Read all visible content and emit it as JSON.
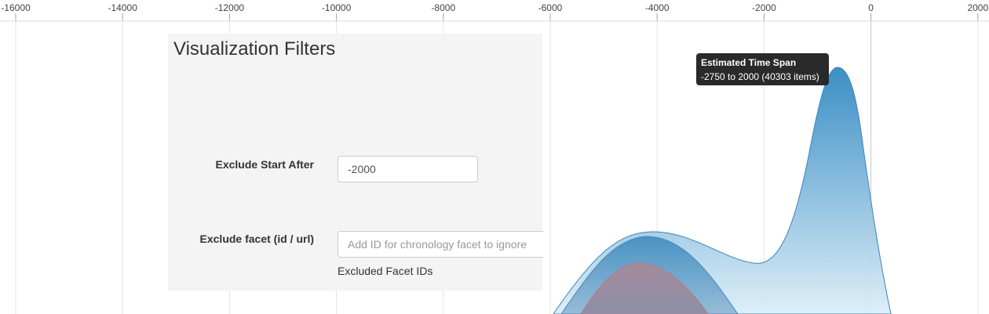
{
  "axis": {
    "ticks": [
      "-16000",
      "-14000",
      "-12000",
      "-10000",
      "-8000",
      "-6000",
      "-4000",
      "-2000",
      "0",
      "2000"
    ]
  },
  "filters_panel": {
    "title": "Visualization Filters",
    "exclude_start_after": {
      "label": "Exclude Start After",
      "value": "-2000"
    },
    "exclude_facet": {
      "label": "Exclude facet (id / url)",
      "placeholder": "Add ID for chronology facet to ignore",
      "help": "Excluded Facet IDs"
    }
  },
  "tooltip": {
    "title": "Estimated Time Span",
    "body": "-2750 to 2000 (40303 items)"
  },
  "colors": {
    "series_primary": "#3a8dc3",
    "series_secondary": "#6aa0c8",
    "series_overlap": "#9e8d9f",
    "tooltip_bg": "#2a2a2a",
    "panel_bg": "#f4f4f4"
  }
}
